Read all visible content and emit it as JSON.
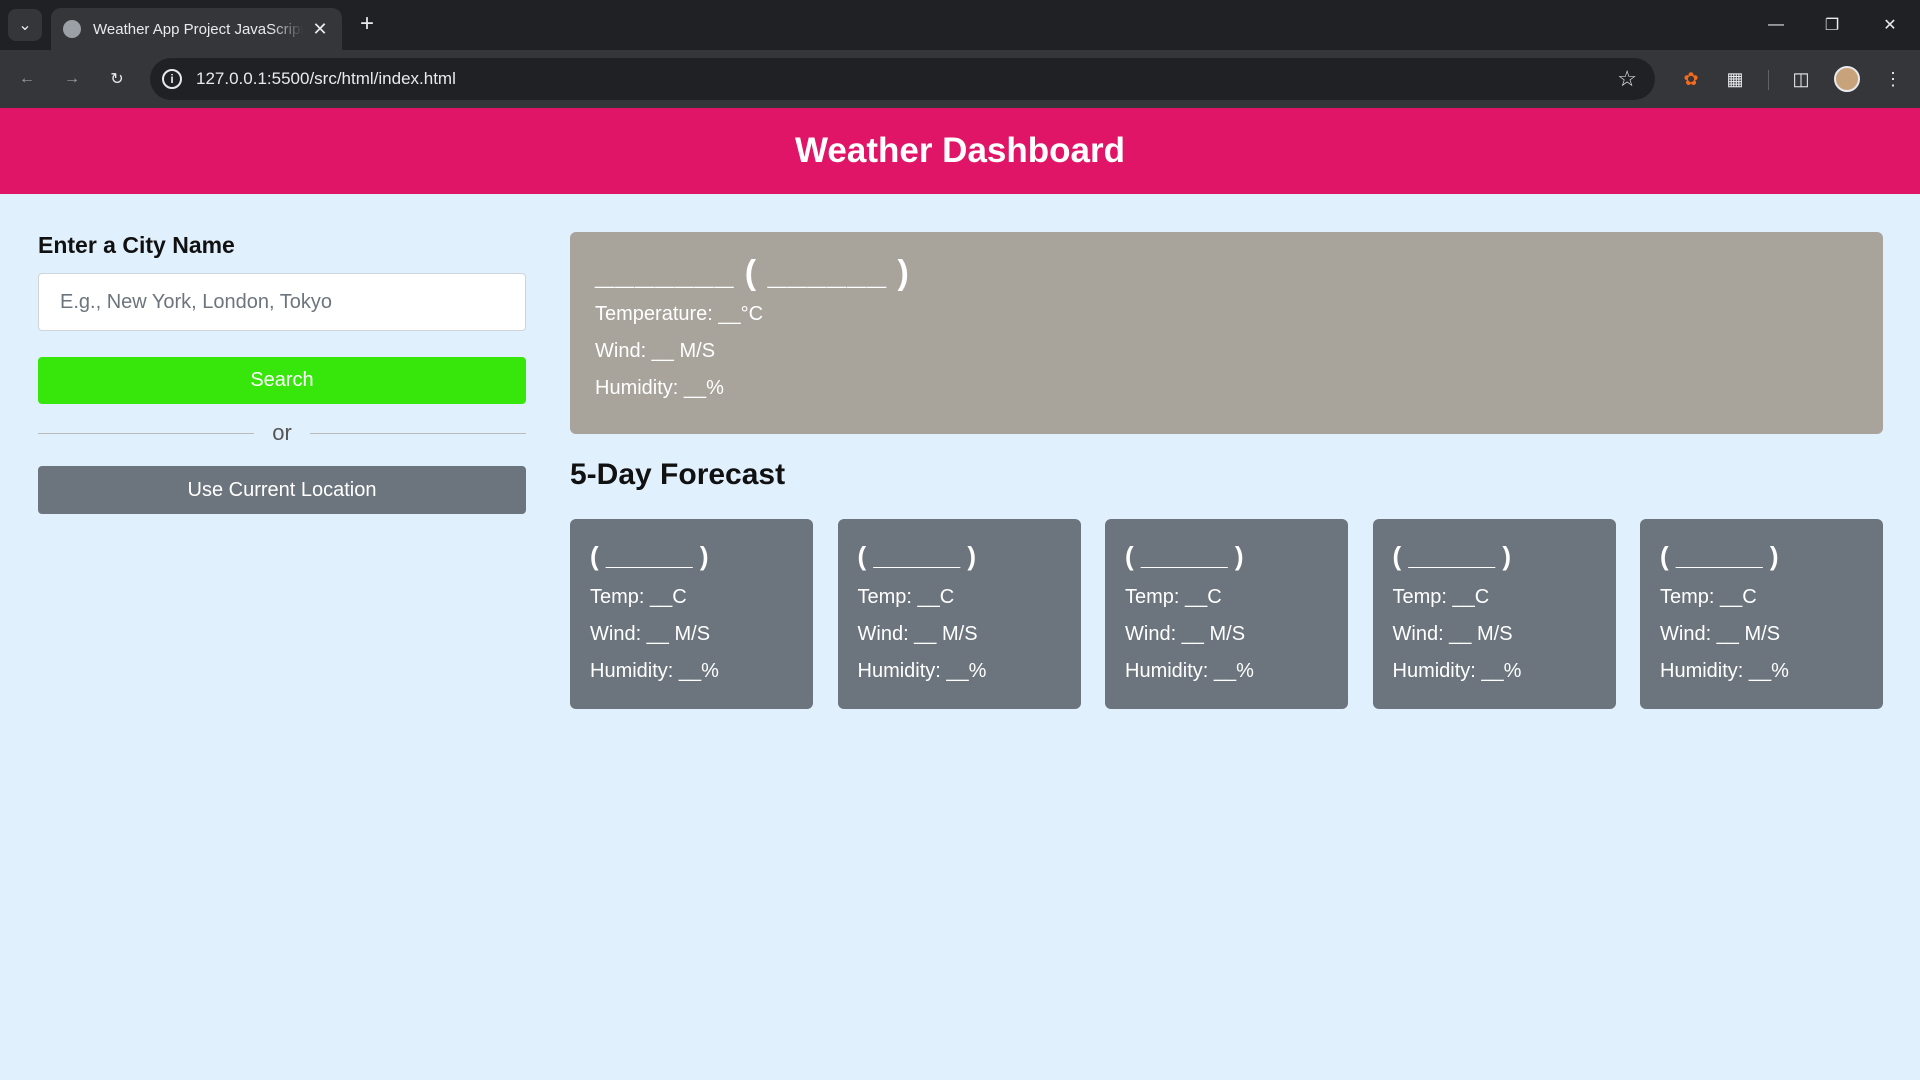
{
  "browser": {
    "tab_title": "Weather App Project JavaScript",
    "url": "127.0.0.1:5500/src/html/index.html"
  },
  "header": {
    "title": "Weather Dashboard"
  },
  "search": {
    "label": "Enter a City Name",
    "placeholder": "E.g., New York, London, Tokyo",
    "search_button": "Search",
    "divider_text": "or",
    "location_button": "Use Current Location"
  },
  "current": {
    "title": "_______ ( ______ )",
    "temperature": "Temperature: __°C",
    "wind": "Wind: __ M/S",
    "humidity": "Humidity: __%"
  },
  "forecast": {
    "heading": "5-Day Forecast",
    "cards": [
      {
        "title": "( ______ )",
        "temp": "Temp: __C",
        "wind": "Wind: __ M/S",
        "humidity": "Humidity: __%"
      },
      {
        "title": "( ______ )",
        "temp": "Temp: __C",
        "wind": "Wind: __ M/S",
        "humidity": "Humidity: __%"
      },
      {
        "title": "( ______ )",
        "temp": "Temp: __C",
        "wind": "Wind: __ M/S",
        "humidity": "Humidity: __%"
      },
      {
        "title": "( ______ )",
        "temp": "Temp: __C",
        "wind": "Wind: __ M/S",
        "humidity": "Humidity: __%"
      },
      {
        "title": "( ______ )",
        "temp": "Temp: __C",
        "wind": "Wind: __ M/S",
        "humidity": "Humidity: __%"
      }
    ]
  },
  "colors": {
    "header_bg": "#e01567",
    "page_bg": "#e1f0fd",
    "search_button": "#37e60a",
    "secondary_button": "#6c757d",
    "current_card": "#a8a39b",
    "forecast_card": "#6c757d"
  }
}
